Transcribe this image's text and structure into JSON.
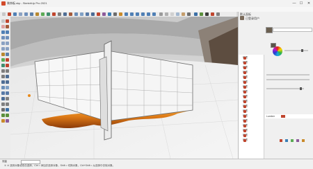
{
  "window": {
    "title": "装饰板.skp - SketchUp Pro 2021",
    "minimize": "—",
    "maximize": "☐",
    "close": "✕"
  },
  "tray": {
    "title": "默认面板",
    "user_name": "已登录用户"
  },
  "materials": {
    "current_name": "Lumber",
    "list_items": [
      "材质",
      "材质",
      "材质",
      "材质",
      "材质",
      "材质",
      "材质",
      "材质",
      "材质",
      "材质",
      "材质",
      "材质",
      "材质",
      "材质",
      "材质",
      "材质",
      "材质",
      "材质"
    ]
  },
  "measurements": {
    "label": "测量"
  },
  "status": {
    "text": "① ② 选择对象或双击选择，Ctrl = 添加并选择对象，Shift = 切换对象，Ctrl+Shift = 从选择中去除对象。"
  },
  "colors": {
    "accent": "#c0452e",
    "fire_orange": "#e8891a",
    "panel_white": "#ffffff"
  },
  "icons": {
    "app": "sketchup-logo-icon",
    "select": "select-arrow-icon",
    "eraser": "eraser-icon",
    "paint": "paint-bucket-icon",
    "orbit": "orbit-icon",
    "pan": "pan-hand-icon",
    "zoom": "zoom-icon"
  }
}
